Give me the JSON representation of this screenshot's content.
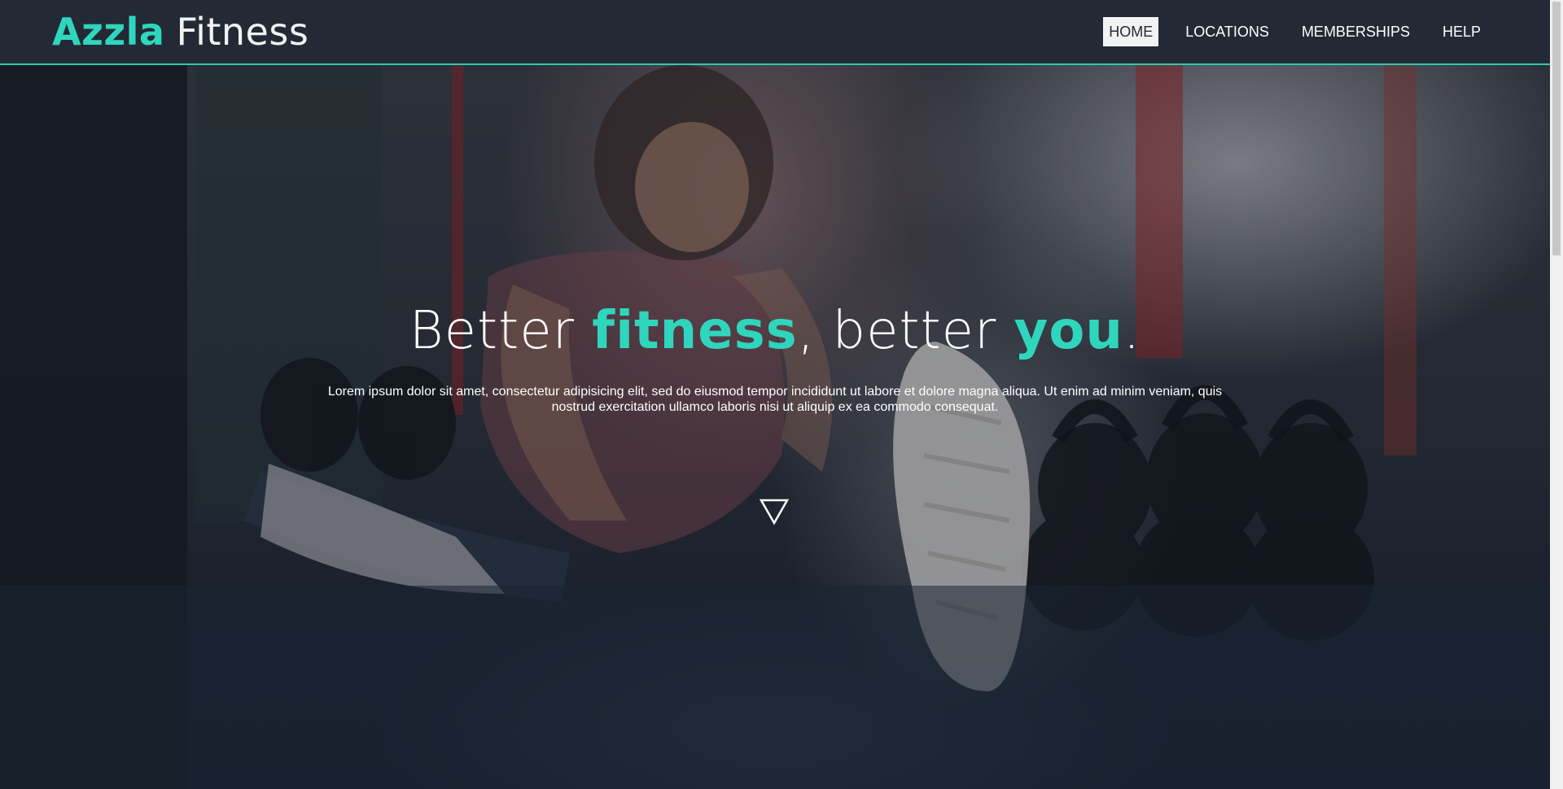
{
  "header": {
    "logo": {
      "brand": "Azzla",
      "name": "Fitness"
    },
    "nav": [
      {
        "label": "HOME",
        "active": true
      },
      {
        "label": "LOCATIONS",
        "active": false
      },
      {
        "label": "MEMBERSHIPS",
        "active": false
      },
      {
        "label": "HELP",
        "active": false
      }
    ]
  },
  "hero": {
    "headline": {
      "part1": "Better ",
      "hl1": "fitness",
      "part2": ", better ",
      "hl2": "you",
      "part3": "."
    },
    "subtext": "Lorem ipsum dolor sit amet, consectetur adipisicing elit, sed do eiusmod tempor incididunt ut labore et dolore magna aliqua. Ut enim ad minim veniam, quis nostrud exercitation ullamco laboris nisi ut aliquip ex ea commodo consequat.",
    "scroll_icon": "down-triangle-icon"
  },
  "colors": {
    "accent": "#2fd6bd",
    "header_bg": "#232a35",
    "nav_active_bg": "#f2f2f2"
  }
}
